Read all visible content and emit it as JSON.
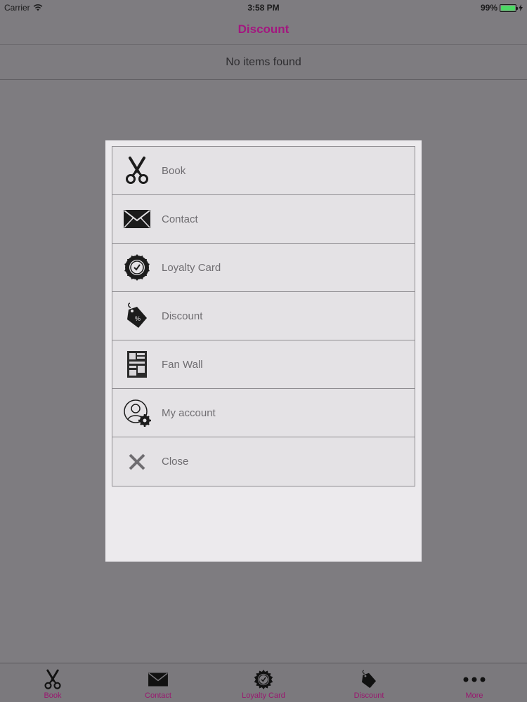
{
  "status_bar": {
    "carrier": "Carrier",
    "time": "3:58 PM",
    "battery": "99%",
    "battery_level": 0.99
  },
  "nav": {
    "title": "Discount"
  },
  "content": {
    "empty_message": "No items found"
  },
  "menu": {
    "items": [
      {
        "label": "Book",
        "icon": "scissors-icon"
      },
      {
        "label": "Contact",
        "icon": "envelope-icon"
      },
      {
        "label": "Loyalty Card",
        "icon": "clock-badge-icon"
      },
      {
        "label": "Discount",
        "icon": "discount-tag-icon"
      },
      {
        "label": "Fan Wall",
        "icon": "fan-wall-icon"
      },
      {
        "label": "My account",
        "icon": "account-settings-icon"
      },
      {
        "label": "Close",
        "icon": "close-icon"
      }
    ]
  },
  "tab_bar": {
    "tabs": [
      {
        "label": "Book",
        "icon": "scissors-icon"
      },
      {
        "label": "Contact",
        "icon": "envelope-icon"
      },
      {
        "label": "Loyalty Card",
        "icon": "clock-badge-icon"
      },
      {
        "label": "Discount",
        "icon": "discount-tag-icon"
      },
      {
        "label": "More",
        "icon": "more-dots-icon"
      }
    ]
  },
  "colors": {
    "accent": "#a3177f",
    "overlay_background": "#7e7c80",
    "modal_background": "#eceaed",
    "battery_green": "#4cd964"
  }
}
